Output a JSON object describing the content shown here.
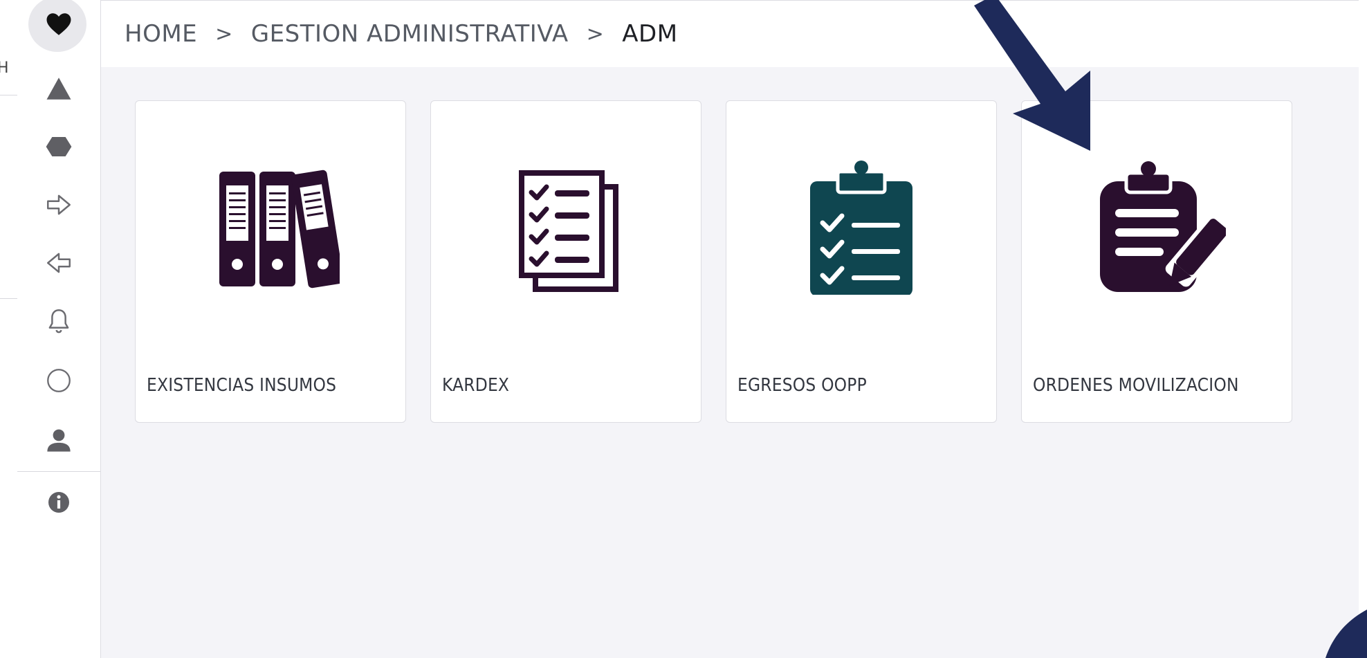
{
  "left_strip": {
    "cut_text": "H"
  },
  "sidebar": {
    "items": [
      {
        "icon": "heart-icon",
        "active": true
      },
      {
        "icon": "triangle-icon"
      },
      {
        "icon": "hexagon-icon"
      },
      {
        "icon": "arrow-right-outline-icon"
      },
      {
        "icon": "arrow-left-outline-icon"
      },
      {
        "icon": "bell-icon"
      },
      {
        "icon": "circle-icon"
      },
      {
        "icon": "user-icon"
      },
      {
        "icon": "info-icon"
      }
    ]
  },
  "breadcrumb": {
    "items": [
      "HOME",
      "GESTION ADMINISTRATIVA",
      "ADM"
    ],
    "separator": ">"
  },
  "cards": [
    {
      "label": "EXISTENCIAS INSUMOS",
      "icon": "binders-icon",
      "color": "#2a0f2e"
    },
    {
      "label": "KARDEX",
      "icon": "checklist-icon",
      "color": "#2a0f2e"
    },
    {
      "label": "EGRESOS OOPP",
      "icon": "clipboard-check-icon",
      "color": "#0f4650"
    },
    {
      "label": "ORDENES MOVILIZACION",
      "icon": "clipboard-edit-icon",
      "color": "#2a0f2e"
    }
  ],
  "colors": {
    "arrow": "#1e2a5a",
    "sidebar_icon": "#6b6b70",
    "content_bg": "#f4f4f8"
  }
}
